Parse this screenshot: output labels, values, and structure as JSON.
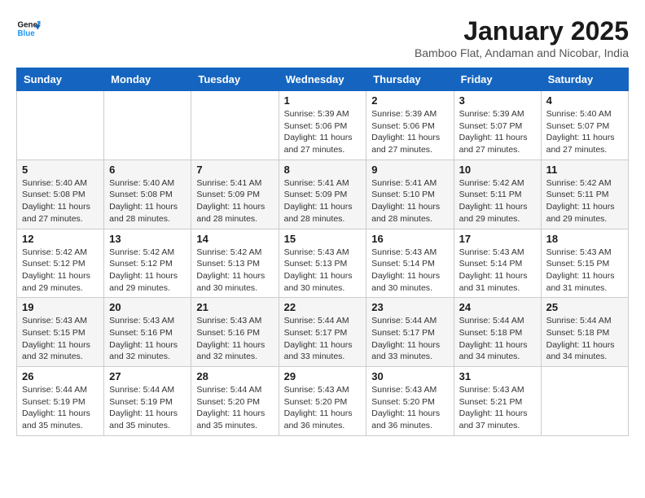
{
  "header": {
    "logo_general": "General",
    "logo_blue": "Blue",
    "month": "January 2025",
    "location": "Bamboo Flat, Andaman and Nicobar, India"
  },
  "weekdays": [
    "Sunday",
    "Monday",
    "Tuesday",
    "Wednesday",
    "Thursday",
    "Friday",
    "Saturday"
  ],
  "weeks": [
    [
      {
        "day": "",
        "sunrise": "",
        "sunset": "",
        "daylight": ""
      },
      {
        "day": "",
        "sunrise": "",
        "sunset": "",
        "daylight": ""
      },
      {
        "day": "",
        "sunrise": "",
        "sunset": "",
        "daylight": ""
      },
      {
        "day": "1",
        "sunrise": "Sunrise: 5:39 AM",
        "sunset": "Sunset: 5:06 PM",
        "daylight": "Daylight: 11 hours and 27 minutes."
      },
      {
        "day": "2",
        "sunrise": "Sunrise: 5:39 AM",
        "sunset": "Sunset: 5:06 PM",
        "daylight": "Daylight: 11 hours and 27 minutes."
      },
      {
        "day": "3",
        "sunrise": "Sunrise: 5:39 AM",
        "sunset": "Sunset: 5:07 PM",
        "daylight": "Daylight: 11 hours and 27 minutes."
      },
      {
        "day": "4",
        "sunrise": "Sunrise: 5:40 AM",
        "sunset": "Sunset: 5:07 PM",
        "daylight": "Daylight: 11 hours and 27 minutes."
      }
    ],
    [
      {
        "day": "5",
        "sunrise": "Sunrise: 5:40 AM",
        "sunset": "Sunset: 5:08 PM",
        "daylight": "Daylight: 11 hours and 27 minutes."
      },
      {
        "day": "6",
        "sunrise": "Sunrise: 5:40 AM",
        "sunset": "Sunset: 5:08 PM",
        "daylight": "Daylight: 11 hours and 28 minutes."
      },
      {
        "day": "7",
        "sunrise": "Sunrise: 5:41 AM",
        "sunset": "Sunset: 5:09 PM",
        "daylight": "Daylight: 11 hours and 28 minutes."
      },
      {
        "day": "8",
        "sunrise": "Sunrise: 5:41 AM",
        "sunset": "Sunset: 5:09 PM",
        "daylight": "Daylight: 11 hours and 28 minutes."
      },
      {
        "day": "9",
        "sunrise": "Sunrise: 5:41 AM",
        "sunset": "Sunset: 5:10 PM",
        "daylight": "Daylight: 11 hours and 28 minutes."
      },
      {
        "day": "10",
        "sunrise": "Sunrise: 5:42 AM",
        "sunset": "Sunset: 5:11 PM",
        "daylight": "Daylight: 11 hours and 29 minutes."
      },
      {
        "day": "11",
        "sunrise": "Sunrise: 5:42 AM",
        "sunset": "Sunset: 5:11 PM",
        "daylight": "Daylight: 11 hours and 29 minutes."
      }
    ],
    [
      {
        "day": "12",
        "sunrise": "Sunrise: 5:42 AM",
        "sunset": "Sunset: 5:12 PM",
        "daylight": "Daylight: 11 hours and 29 minutes."
      },
      {
        "day": "13",
        "sunrise": "Sunrise: 5:42 AM",
        "sunset": "Sunset: 5:12 PM",
        "daylight": "Daylight: 11 hours and 29 minutes."
      },
      {
        "day": "14",
        "sunrise": "Sunrise: 5:42 AM",
        "sunset": "Sunset: 5:13 PM",
        "daylight": "Daylight: 11 hours and 30 minutes."
      },
      {
        "day": "15",
        "sunrise": "Sunrise: 5:43 AM",
        "sunset": "Sunset: 5:13 PM",
        "daylight": "Daylight: 11 hours and 30 minutes."
      },
      {
        "day": "16",
        "sunrise": "Sunrise: 5:43 AM",
        "sunset": "Sunset: 5:14 PM",
        "daylight": "Daylight: 11 hours and 30 minutes."
      },
      {
        "day": "17",
        "sunrise": "Sunrise: 5:43 AM",
        "sunset": "Sunset: 5:14 PM",
        "daylight": "Daylight: 11 hours and 31 minutes."
      },
      {
        "day": "18",
        "sunrise": "Sunrise: 5:43 AM",
        "sunset": "Sunset: 5:15 PM",
        "daylight": "Daylight: 11 hours and 31 minutes."
      }
    ],
    [
      {
        "day": "19",
        "sunrise": "Sunrise: 5:43 AM",
        "sunset": "Sunset: 5:15 PM",
        "daylight": "Daylight: 11 hours and 32 minutes."
      },
      {
        "day": "20",
        "sunrise": "Sunrise: 5:43 AM",
        "sunset": "Sunset: 5:16 PM",
        "daylight": "Daylight: 11 hours and 32 minutes."
      },
      {
        "day": "21",
        "sunrise": "Sunrise: 5:43 AM",
        "sunset": "Sunset: 5:16 PM",
        "daylight": "Daylight: 11 hours and 32 minutes."
      },
      {
        "day": "22",
        "sunrise": "Sunrise: 5:44 AM",
        "sunset": "Sunset: 5:17 PM",
        "daylight": "Daylight: 11 hours and 33 minutes."
      },
      {
        "day": "23",
        "sunrise": "Sunrise: 5:44 AM",
        "sunset": "Sunset: 5:17 PM",
        "daylight": "Daylight: 11 hours and 33 minutes."
      },
      {
        "day": "24",
        "sunrise": "Sunrise: 5:44 AM",
        "sunset": "Sunset: 5:18 PM",
        "daylight": "Daylight: 11 hours and 34 minutes."
      },
      {
        "day": "25",
        "sunrise": "Sunrise: 5:44 AM",
        "sunset": "Sunset: 5:18 PM",
        "daylight": "Daylight: 11 hours and 34 minutes."
      }
    ],
    [
      {
        "day": "26",
        "sunrise": "Sunrise: 5:44 AM",
        "sunset": "Sunset: 5:19 PM",
        "daylight": "Daylight: 11 hours and 35 minutes."
      },
      {
        "day": "27",
        "sunrise": "Sunrise: 5:44 AM",
        "sunset": "Sunset: 5:19 PM",
        "daylight": "Daylight: 11 hours and 35 minutes."
      },
      {
        "day": "28",
        "sunrise": "Sunrise: 5:44 AM",
        "sunset": "Sunset: 5:20 PM",
        "daylight": "Daylight: 11 hours and 35 minutes."
      },
      {
        "day": "29",
        "sunrise": "Sunrise: 5:43 AM",
        "sunset": "Sunset: 5:20 PM",
        "daylight": "Daylight: 11 hours and 36 minutes."
      },
      {
        "day": "30",
        "sunrise": "Sunrise: 5:43 AM",
        "sunset": "Sunset: 5:20 PM",
        "daylight": "Daylight: 11 hours and 36 minutes."
      },
      {
        "day": "31",
        "sunrise": "Sunrise: 5:43 AM",
        "sunset": "Sunset: 5:21 PM",
        "daylight": "Daylight: 11 hours and 37 minutes."
      },
      {
        "day": "",
        "sunrise": "",
        "sunset": "",
        "daylight": ""
      }
    ]
  ]
}
